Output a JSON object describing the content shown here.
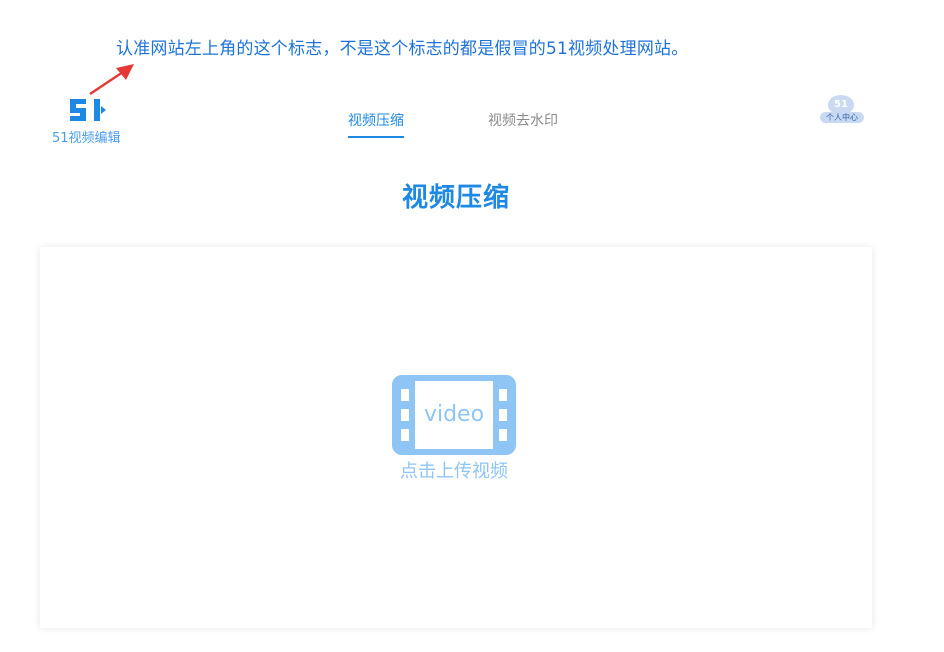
{
  "annotation": {
    "text": "认准网站左上角的这个标志，不是这个标志的都是假冒的51视频处理网站。",
    "arrow_icon": "red-arrow-icon"
  },
  "header": {
    "logo_mark": "51",
    "logo_text": "51视频编辑",
    "nav": {
      "tabs": [
        {
          "label": "视频压缩",
          "active": true
        },
        {
          "label": "视频去水印",
          "active": false
        }
      ]
    },
    "user": {
      "avatar_text": "51",
      "label": "个人中心"
    }
  },
  "main": {
    "title": "视频压缩",
    "upload": {
      "icon_text": "video",
      "label": "点击上传视频"
    }
  },
  "colors": {
    "brand": "#1e88e5",
    "annotation": "#1e73d9",
    "upload_icon": "#8ec5f5",
    "arrow": "#e53935"
  }
}
